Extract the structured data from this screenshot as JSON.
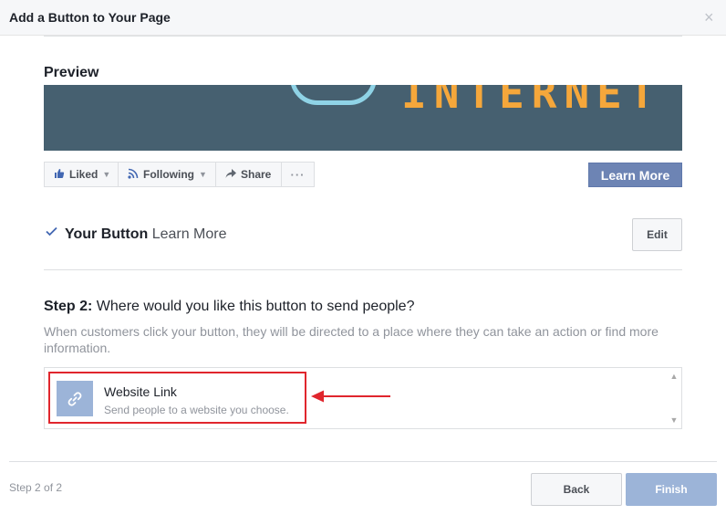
{
  "dialog": {
    "title": "Add a Button to Your Page",
    "close_glyph": "×"
  },
  "preview": {
    "label": "Preview",
    "cover_text": "INTERNET"
  },
  "action_bar": {
    "liked": "Liked",
    "following": "Following",
    "share": "Share",
    "more": "···"
  },
  "cta_button": "Learn More",
  "your_button": {
    "label": "Your Button",
    "value": "Learn More",
    "edit": "Edit"
  },
  "step": {
    "prefix": "Step 2:",
    "question": "Where would you like this button to send people?",
    "description": "When customers click your button, they will be directed to a place where they can take an action or find more information."
  },
  "options": [
    {
      "title": "Website Link",
      "subtitle": "Send people to a website you choose."
    }
  ],
  "footer": {
    "step_counter": "Step 2 of 2",
    "back": "Back",
    "finish": "Finish"
  },
  "icons": {
    "close": "close-icon",
    "thumbs_up": "thumbs-up-icon",
    "rss": "rss-icon",
    "share": "share-icon",
    "check": "check-icon",
    "link": "link-icon"
  },
  "colors": {
    "accent": "#4267b2",
    "cta": "#6d84b4",
    "disabled_primary": "#9cb4d8",
    "annotation": "#e0262d"
  }
}
